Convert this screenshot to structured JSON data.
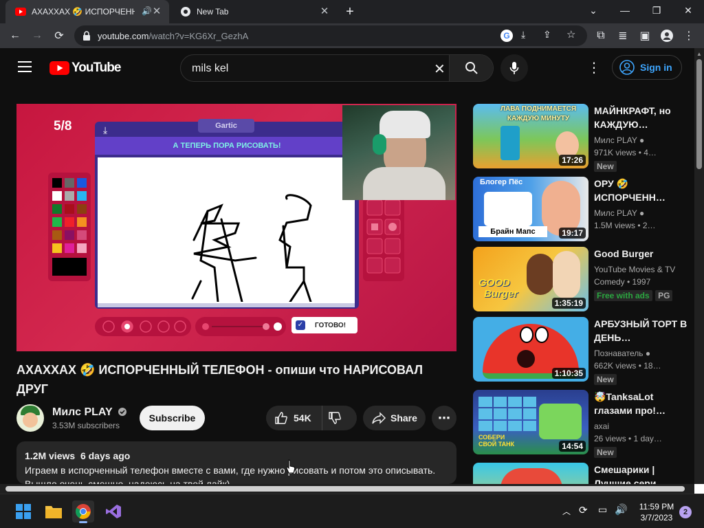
{
  "browser": {
    "tabs": [
      {
        "title": "АХАХХАХ 🤣 ИСПОРЧЕННЫЙ",
        "active": true
      },
      {
        "title": "New Tab",
        "active": false
      }
    ],
    "url_host": "youtube.com",
    "url_path": "/watch?v=KG6Xr_GezhA"
  },
  "yt": {
    "logo_text": "YouTube",
    "search_value": "mils kel",
    "signin_label": "Sign in"
  },
  "game": {
    "counter": "5/8",
    "logo": "Gartic",
    "prompt": "А ТЕПЕРЬ ПОРА РИСОВАТЬ!",
    "done_label": "ГОТОВО!"
  },
  "video": {
    "title": "АХАХХАХ 🤣 ИСПОРЧЕННЫЙ ТЕЛЕФОН - опиши что НАРИСОВАЛ ДРУГ",
    "channel": "Милс PLAY",
    "subscribers": "3.53M subscribers",
    "subscribe_label": "Subscribe",
    "likes": "54K",
    "share_label": "Share",
    "views": "1.2M views",
    "age": "6 days ago",
    "desc_line1": "Играем в испорченный телефон вместе с вами, где нужно рисовать и потом это описывать.",
    "desc_line2": "Вышло очень смешно, надеюсь на твой лайк)"
  },
  "recommendations": [
    {
      "title": "МАЙНКРАФТ, но КАЖДУЮ…",
      "channel": "Милс PLAY",
      "verified": true,
      "meta": "971K views • 4…",
      "badge": "New",
      "duration": "17:26",
      "thumb_top": "ЛАВА ПОДНИМАЕТСЯ",
      "thumb_bottom": "КАЖДУЮ МИНУТУ"
    },
    {
      "title": "ОРУ 🤣 ИСПОРЧЕНН…",
      "channel": "Милс PLAY",
      "verified": true,
      "meta": "1.5M views • 2…",
      "badge": "",
      "duration": "19:17",
      "thumb_top": "Блогер Пёс",
      "thumb_bottom": "Брайн Мапс"
    },
    {
      "title": "Good Burger",
      "channel": "YouTube Movies & TV",
      "verified": false,
      "meta": "Comedy • 1997",
      "badge": "Free with ads",
      "badge2": "PG",
      "duration": "1:35:19",
      "thumb_top": "GOOD",
      "thumb_bottom": "Burger"
    },
    {
      "title": "АРБУЗНЫЙ ТОРТ В ДЕНЬ…",
      "channel": "Познаватель",
      "verified": true,
      "meta": "662K views • 18…",
      "badge": "New",
      "duration": "1:10:35",
      "thumb_top": "",
      "thumb_bottom": ""
    },
    {
      "title": "🤯TanksaLot глазами про!…",
      "channel": "axai",
      "verified": false,
      "meta": "26 views • 1 day…",
      "badge": "New",
      "duration": "14:54",
      "thumb_top": "",
      "thumb_bottom": "СОБЕРИ СВОЙ ТАНК"
    },
    {
      "title": "Смешарики | Лучшие сери…",
      "channel": "",
      "verified": false,
      "meta": "",
      "badge": "",
      "duration": "",
      "thumb_top": "",
      "thumb_bottom": ""
    }
  ],
  "taskbar": {
    "time": "11:59 PM",
    "date": "3/7/2023",
    "notifications": "2"
  }
}
